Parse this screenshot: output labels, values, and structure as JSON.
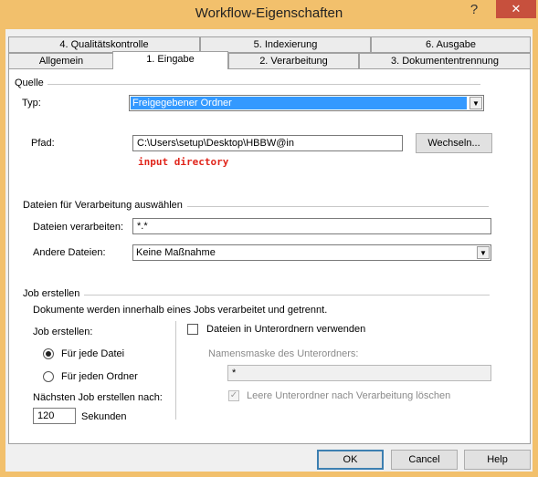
{
  "window": {
    "title": "Workflow-Eigenschaften",
    "help_glyph": "?",
    "close_glyph": "✕"
  },
  "tabs_row1": [
    "4. Qualitätskontrolle",
    "5. Indexierung",
    "6. Ausgabe"
  ],
  "tabs_row2": [
    "Allgemein",
    "1. Eingabe",
    "2. Verarbeitung",
    "3. Dokumententrennung"
  ],
  "active_tab": "1. Eingabe",
  "source": {
    "section": "Quelle",
    "type_label": "Typ:",
    "type_value": "Freigegebener Ordner",
    "path_label": "Pfad:",
    "path_value": "C:\\Users\\setup\\Desktop\\HBBW@in",
    "browse_button": "Wechseln...",
    "annotation": "input directory"
  },
  "files": {
    "section": "Dateien für Verarbeitung auswählen",
    "process_label": "Dateien verarbeiten:",
    "process_value": "*.*",
    "other_label": "Andere Dateien:",
    "other_value": "Keine Maßnahme"
  },
  "job": {
    "section": "Job erstellen",
    "description": "Dokumente werden innerhalb eines Jobs verarbeitet und getrennt.",
    "create_label": "Job erstellen:",
    "radio_each_file": "Für jede Datei",
    "radio_each_folder": "Für jeden Ordner",
    "selected": "each_file",
    "next_job_label": "Nächsten Job erstellen nach:",
    "seconds_value": "120",
    "seconds_unit": "Sekunden",
    "subfolders_label": "Dateien in Unterordnern verwenden",
    "subfolders_checked": false,
    "mask_label": "Namensmaske des Unterordners:",
    "mask_value": "*",
    "delete_empty_label": "Leere Unterordner nach Verarbeitung löschen",
    "delete_empty_checked": true
  },
  "footer": {
    "ok": "OK",
    "cancel": "Cancel",
    "help": "Help"
  },
  "colors": {
    "titlebar": "#f2c06c",
    "close": "#c7503d",
    "selection": "#3399ff",
    "annotation": "#e0251b"
  }
}
